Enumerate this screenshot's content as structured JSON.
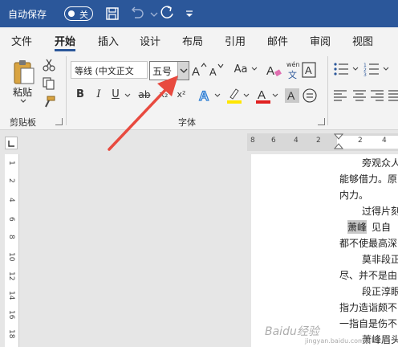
{
  "titlebar": {
    "autosave_label": "自动保存",
    "autosave_state": "关",
    "icons": [
      "save-icon",
      "undo-icon",
      "redo-icon",
      "customize-quick-access-icon"
    ]
  },
  "tabs": [
    "文件",
    "开始",
    "插入",
    "设计",
    "布局",
    "引用",
    "邮件",
    "审阅",
    "视图"
  ],
  "active_tab": "开始",
  "ribbon": {
    "clipboard": {
      "paste_label": "粘贴",
      "group_label": "剪贴板"
    },
    "font": {
      "font_name": "等线 (中文正文",
      "font_size": "五号",
      "change_case": "Aa",
      "phonetic_guide": "wén",
      "phonetic_char": "文",
      "group_label": "字体",
      "format_buttons": [
        "B",
        "I",
        "U",
        "ab",
        "x₂",
        "x²"
      ]
    }
  },
  "ruler": {
    "horizontal": [
      "8",
      "6",
      "4",
      "2",
      "2",
      "4"
    ],
    "vertical": [
      "1",
      "2",
      "4",
      "6",
      "8",
      "10",
      "12",
      "14",
      "16",
      "18"
    ]
  },
  "document": {
    "lines": [
      "旁观众人",
      "能够借力。原",
      "内力。",
      "过得片刻",
      "萧峰",
      "见自",
      "都不使最高深",
      "莫非段正",
      "尽、并不是由",
      "段正淳眼",
      "指力造诣颇不",
      "一指自是伤不",
      "萧峰眉头"
    ]
  },
  "watermark": {
    "text": "Baidu经验",
    "sub": "jingyan.baidu.com"
  },
  "colors": {
    "titlebar": "#2b579a",
    "ribbon": "#f3f3f3",
    "arrow": "#e84a3f",
    "highlighter": "#ffe600",
    "font_color": "#e02020"
  }
}
